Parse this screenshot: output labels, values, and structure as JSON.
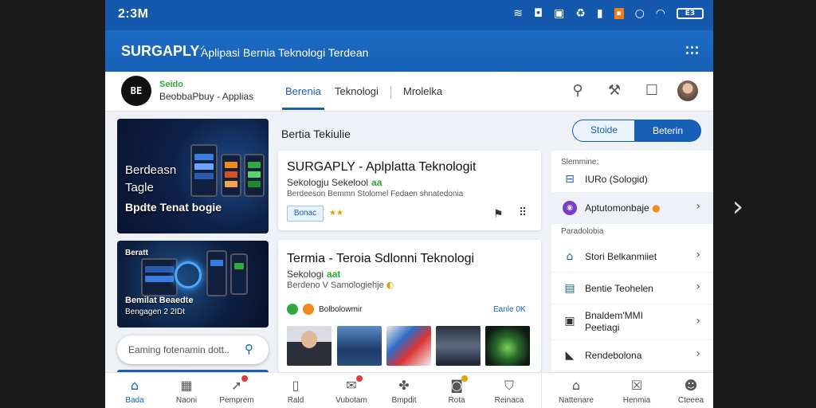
{
  "status_bar": {
    "time": "2:3M",
    "icons": [
      "signal-waves-icon",
      "app-icon",
      "camera-icon",
      "sync-icon",
      "cell-signal-icon",
      "notification-icon",
      "dot-icon",
      "wifi-icon"
    ],
    "battery": "E3"
  },
  "app_bar": {
    "brand": "SURGAPLY",
    "subtitle": "Aplipasi Bernia Teknologi Terdean"
  },
  "nav": {
    "logo_text": "BE",
    "brand_line1": "Seido",
    "brand_line2": "BeobbaPbuy",
    "brand_suffix": "- Applias",
    "tabs": [
      {
        "label": "Berenia",
        "active": true
      },
      {
        "label": "Teknologi"
      },
      {
        "label": "Mrolelka"
      }
    ]
  },
  "featured": [
    {
      "title": "Berdeasn Tagle",
      "subtitle": "Bpdte Tenat bogie"
    },
    {
      "title": "Beratt",
      "line2": "Bemilat Beaedte",
      "line3": "Bengagen 2 2IDt"
    }
  ],
  "search": {
    "placeholder": "Eaming fotenamin dott.."
  },
  "section_title": "Bertia Tekiulie",
  "toggle": {
    "option1": "Stoide",
    "option2": "Beterin"
  },
  "cards": [
    {
      "title": "SURGAPLY - Aplplatta Teknologit",
      "line2": "Sekologju Sekelool",
      "badge": "aa",
      "line3": "Berdeeson Bemmn Stolomel Fedaen shnatedonia",
      "tag": "Bonac",
      "stars": "★★"
    },
    {
      "title": "Termia - Teroia Sdlonni Teknologi",
      "line2": "Sekologi",
      "badge": "aat",
      "line3": "Berdeno V Samologiehje",
      "source": "Bolbolowmir",
      "source_link": "Eanle 0K"
    }
  ],
  "menu": {
    "label1": "Slemmine:",
    "item0": "IURo (Sologid)",
    "item_hl": "Aptutomonbaje",
    "label2": "Paradolobia",
    "items": [
      {
        "icon": "building-icon",
        "text": "Stori Belkanmiiet"
      },
      {
        "icon": "calendar-icon",
        "text": "Bentie Teohelen"
      },
      {
        "icon": "person-card-icon",
        "text": "Bnaldem'MMI Peetiagi"
      },
      {
        "icon": "tag-icon",
        "text": "Rendebolona"
      }
    ]
  },
  "bottom_nav": [
    {
      "label": "Bada",
      "icon": "home-icon",
      "active": true
    },
    {
      "label": "Naoni",
      "icon": "news-icon"
    },
    {
      "label": "Pemprem",
      "icon": "send-icon",
      "badge": "red"
    },
    {
      "label": "Rald",
      "icon": "tablet-icon"
    },
    {
      "label": "Vubotam",
      "icon": "mail-icon",
      "badge": "red"
    },
    {
      "label": "Bmpdit",
      "icon": "puzzle-icon"
    },
    {
      "label": "Rota",
      "icon": "chat-icon",
      "badge": "amber"
    },
    {
      "label": "Reinaca",
      "icon": "shield-icon"
    },
    {
      "label": "Nattenare",
      "icon": "house-outline-icon"
    },
    {
      "label": "Henmia",
      "icon": "inbox-icon"
    },
    {
      "label": "Cteeea",
      "icon": "person-icon"
    }
  ],
  "colors": {
    "brand_blue": "#1760b6",
    "accent_green": "#2eaa3c",
    "accent_amber": "#e0a400"
  }
}
